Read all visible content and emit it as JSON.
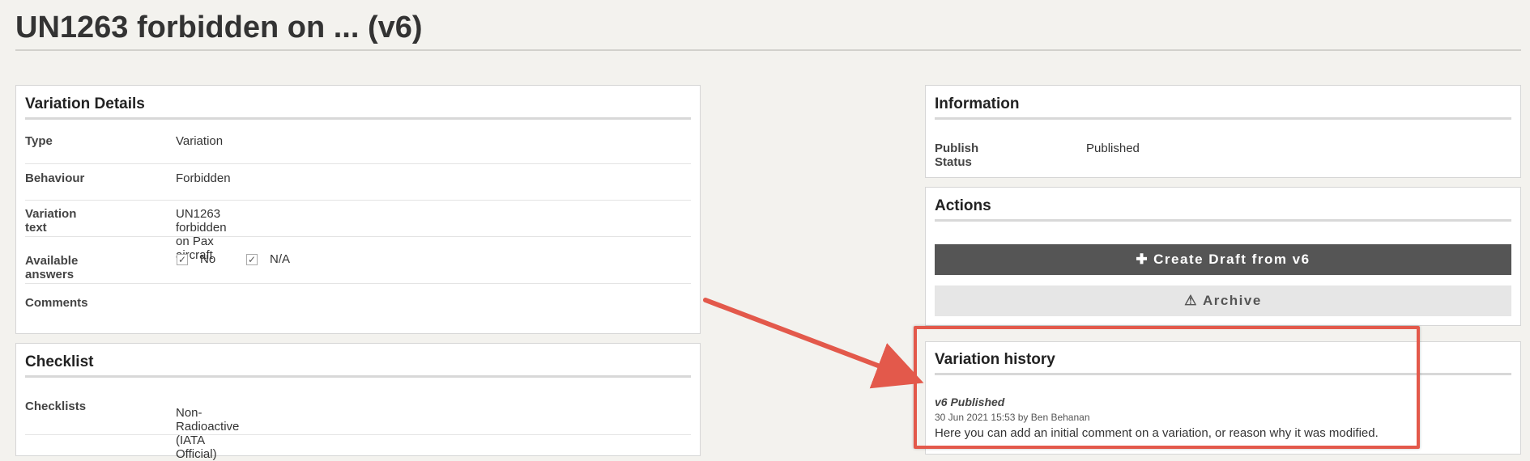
{
  "page": {
    "title": "UN1263 forbidden on ... (v6)"
  },
  "variation_details": {
    "title": "Variation Details",
    "rows": [
      {
        "label": "Type",
        "value": "Variation"
      },
      {
        "label": "Behaviour",
        "value": "Forbidden"
      },
      {
        "label": "Variation text",
        "value": "UN1263 forbidden on Pax aircraft"
      },
      {
        "label": "Available answers",
        "answers": [
          {
            "label": "No",
            "checked": true
          },
          {
            "label": "N/A",
            "checked": true
          }
        ]
      },
      {
        "label": "Comments",
        "value": ""
      }
    ]
  },
  "checklist": {
    "title": "Checklist",
    "rows": [
      {
        "label": "Checklists",
        "value": "Non-Radioactive (IATA Official)"
      }
    ]
  },
  "information": {
    "title": "Information",
    "rows": [
      {
        "label": "Publish Status",
        "value": "Published"
      }
    ]
  },
  "actions": {
    "title": "Actions",
    "create_draft_label": "Create Draft from v6",
    "archive_label": "Archive"
  },
  "variation_history": {
    "title": "Variation history",
    "entries": [
      {
        "version": "v6 Published",
        "meta": "30 Jun 2021 15:53 by Ben Behanan",
        "comment": "Here you can add an initial comment on a variation, or reason why it was modified."
      }
    ]
  },
  "colors": {
    "background": "#f3f2ee",
    "button_dark": "#555555",
    "button_light": "#e6e6e6",
    "annotation": "#e3594b"
  },
  "icons": {
    "check": "check-icon",
    "plus": "plus-icon",
    "warning": "warning-icon"
  }
}
